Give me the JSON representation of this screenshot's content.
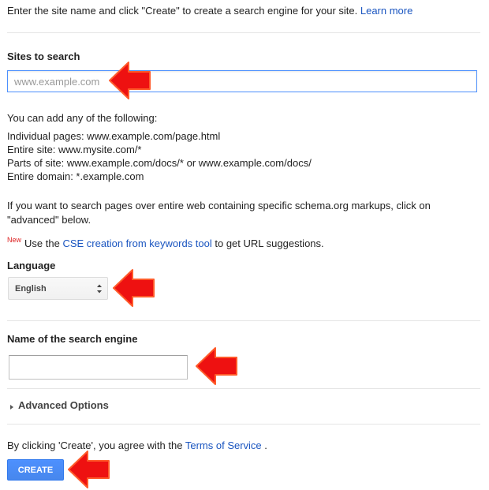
{
  "intro": {
    "text": "Enter the site name and click \"Create\" to create a search engine for your site.",
    "learn_more": "Learn more"
  },
  "sites": {
    "label": "Sites to search",
    "placeholder": "www.example.com",
    "value": ""
  },
  "help": {
    "intro": "You can add any of the following:",
    "lines": [
      "Individual pages: www.example.com/page.html",
      "Entire site: www.mysite.com/*",
      "Parts of site: www.example.com/docs/* or www.example.com/docs/",
      "Entire domain: *.example.com"
    ],
    "schema_line1": "If you want to search pages over entire web containing specific schema.org markups, click on",
    "schema_line2": "\"advanced\" below."
  },
  "keywords_tool": {
    "badge": "New",
    "prefix": "Use the",
    "link": "CSE creation from keywords tool",
    "suffix": "to get URL suggestions."
  },
  "language": {
    "label": "Language",
    "selected": "English"
  },
  "engine_name": {
    "label": "Name of the search engine",
    "value": ""
  },
  "advanced": {
    "label": "Advanced Options"
  },
  "terms": {
    "prefix": "By clicking 'Create', you agree with the",
    "link": "Terms of Service",
    "suffix": "."
  },
  "create_button": {
    "label": "CREATE"
  },
  "colors": {
    "link": "#1a55c0",
    "button": "#4d90fe",
    "arrow": "#ee1111",
    "new_badge": "#dd2222"
  }
}
